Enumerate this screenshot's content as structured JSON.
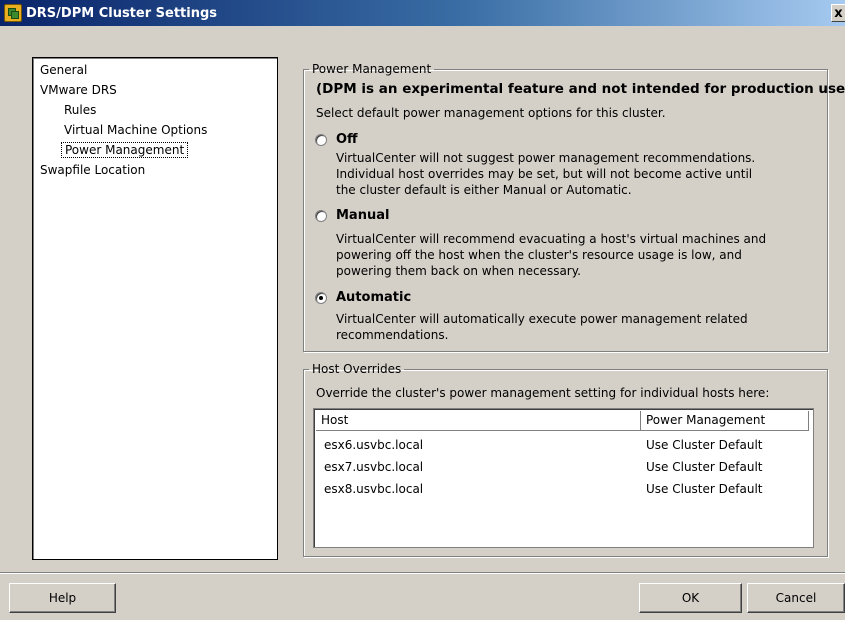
{
  "window": {
    "title": "DRS/DPM Cluster Settings",
    "close_glyph": "x"
  },
  "nav": {
    "items": [
      {
        "label": "General",
        "level": 0,
        "selected": false
      },
      {
        "label": "VMware DRS",
        "level": 0,
        "selected": false
      },
      {
        "label": "Rules",
        "level": 1,
        "selected": false
      },
      {
        "label": "Virtual Machine Options",
        "level": 1,
        "selected": false
      },
      {
        "label": "Power Management",
        "level": 1,
        "selected": true
      },
      {
        "label": "Swapfile Location",
        "level": 0,
        "selected": false
      }
    ]
  },
  "power_management": {
    "legend": "Power Management",
    "warning": "(DPM is an experimental feature and not intended for production use)",
    "instruction": "Select default power management options for this cluster.",
    "selected_option": "Automatic",
    "options": [
      {
        "label": "Off",
        "checked": false,
        "description": [
          "VirtualCenter will not suggest power management recommendations.",
          "Individual host overrides may be set, but will not become active until",
          "the cluster default is either Manual or Automatic."
        ]
      },
      {
        "label": "Manual",
        "checked": false,
        "description": [
          "VirtualCenter will recommend evacuating a host's virtual machines and",
          "powering off the host when the cluster's resource usage is low, and",
          "powering them back on when necessary."
        ]
      },
      {
        "label": "Automatic",
        "checked": true,
        "description": [
          "VirtualCenter will automatically execute power management related",
          "recommendations."
        ]
      }
    ]
  },
  "host_overrides": {
    "legend": "Host Overrides",
    "instruction": "Override the cluster's power management setting for individual hosts here:",
    "columns": [
      "Host",
      "Power Management"
    ],
    "rows": [
      {
        "host": "esx6.usvbc.local",
        "power_management": "Use Cluster Default"
      },
      {
        "host": "esx7.usvbc.local",
        "power_management": "Use Cluster Default"
      },
      {
        "host": "esx8.usvbc.local",
        "power_management": "Use Cluster Default"
      }
    ]
  },
  "buttons": {
    "help": "Help",
    "ok": "OK",
    "cancel": "Cancel"
  }
}
